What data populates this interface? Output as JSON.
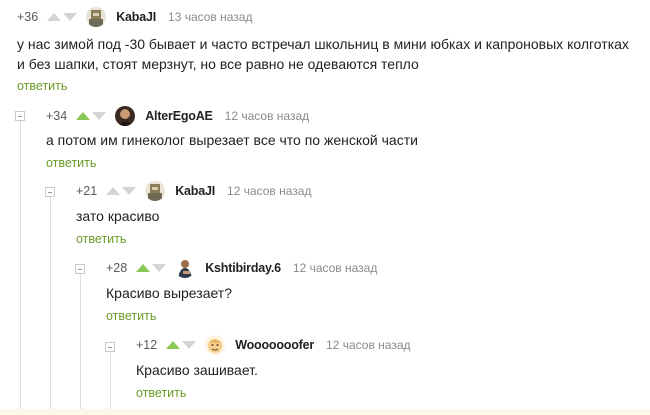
{
  "comments": [
    {
      "rating": "+36",
      "author": "KabaJI",
      "time": "13 часов назад",
      "text": "у нас зимой под -30 бывает и часто встречал школьниц в мини юбках и капроновых колготках и без шапки, стоят мерзнут, но все равно не одеваются тепло",
      "reply": "ответить",
      "upvoted": false
    },
    {
      "rating": "+34",
      "author": "AlterEgoAE",
      "time": "12 часов назад",
      "text": "а потом им гинеколог вырезает все что по женской части",
      "reply": "ответить",
      "upvoted": true
    },
    {
      "rating": "+21",
      "author": "KabaJI",
      "time": "12 часов назад",
      "text": "зато красиво",
      "reply": "ответить",
      "upvoted": false
    },
    {
      "rating": "+28",
      "author": "Kshtibirday.6",
      "time": "12 часов назад",
      "text": "Красиво вырезает?",
      "reply": "ответить",
      "upvoted": true
    },
    {
      "rating": "+12",
      "author": "Wooooooofer",
      "time": "12 часов назад",
      "text": "Красиво зашивает.",
      "reply": "ответить",
      "upvoted": true
    }
  ],
  "colors": {
    "upvote_active": "#8ac858",
    "vote_inactive": "#d4d4d4",
    "reply_link": "#6b9a26"
  }
}
